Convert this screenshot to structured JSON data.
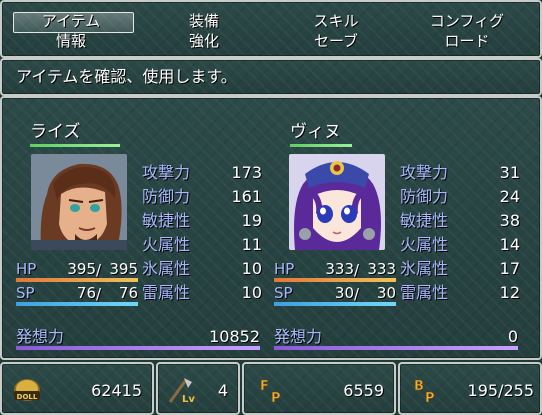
{
  "menu": {
    "items": [
      {
        "label": "アイテム"
      },
      {
        "label": "装備"
      },
      {
        "label": "スキル"
      },
      {
        "label": "コンフィグ"
      },
      {
        "label": "情報"
      },
      {
        "label": "強化"
      },
      {
        "label": "セーブ"
      },
      {
        "label": "ロード"
      }
    ],
    "selected": "アイテム"
  },
  "help": {
    "text": "アイテムを確認、使用します。"
  },
  "actors": [
    {
      "name": "ライズ",
      "stats": [
        {
          "label": "攻撃力",
          "value": "173"
        },
        {
          "label": "防御力",
          "value": "161"
        },
        {
          "label": "敏捷性",
          "value": "19"
        },
        {
          "label": "火属性",
          "value": "11"
        },
        {
          "label": "氷属性",
          "value": "10"
        },
        {
          "label": "雷属性",
          "value": "10"
        }
      ],
      "hp": {
        "label": "HP",
        "current": "395",
        "max": "395",
        "fill": 1.0
      },
      "sp": {
        "label": "SP",
        "current": "76",
        "max": "76",
        "fill": 1.0
      },
      "idea": {
        "label": "発想力",
        "value": "10852",
        "fill": 1.0
      }
    },
    {
      "name": "ヴィヌ",
      "stats": [
        {
          "label": "攻撃力",
          "value": "31"
        },
        {
          "label": "防御力",
          "value": "24"
        },
        {
          "label": "敏捷性",
          "value": "38"
        },
        {
          "label": "火属性",
          "value": "14"
        },
        {
          "label": "氷属性",
          "value": "17"
        },
        {
          "label": "雷属性",
          "value": "12"
        }
      ],
      "hp": {
        "label": "HP",
        "current": "333",
        "max": "333",
        "fill": 1.0
      },
      "sp": {
        "label": "SP",
        "current": "30",
        "max": "30",
        "fill": 1.0
      },
      "idea": {
        "label": "発想力",
        "value": "0",
        "fill": 1.0
      }
    }
  ],
  "resources": {
    "doll": {
      "icon": "doll-coin-icon",
      "icon_text": "DOLL",
      "value": "62415"
    },
    "lv": {
      "icon": "level-icon",
      "icon_text": "Lv",
      "value": "4"
    },
    "fp": {
      "icon": "fp-icon",
      "icon_text": "FP",
      "value": "6559"
    },
    "bp": {
      "icon": "bp-icon",
      "icon_text": "BP",
      "value": "195/255"
    }
  }
}
